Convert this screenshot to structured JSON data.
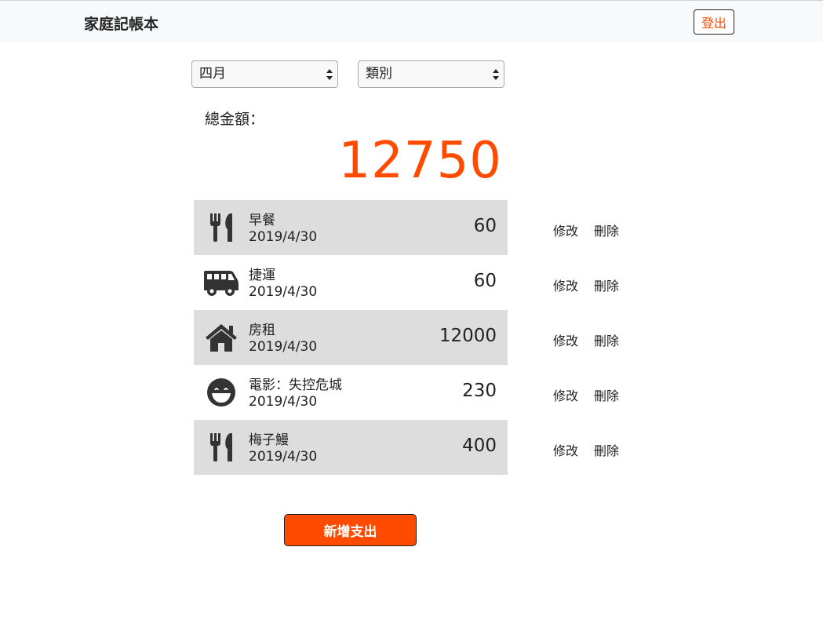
{
  "header": {
    "brand": "家庭記帳本",
    "logout_label": "登出"
  },
  "filters": {
    "month": "四月",
    "category": "類別"
  },
  "summary": {
    "label": "總金額：",
    "total": "12750"
  },
  "expenses": [
    {
      "icon": "utensils-icon",
      "name": "早餐",
      "date": "2019/4/30",
      "amount": "60"
    },
    {
      "icon": "van-icon",
      "name": "捷運",
      "date": "2019/4/30",
      "amount": "60"
    },
    {
      "icon": "home-icon",
      "name": "房租",
      "date": "2019/4/30",
      "amount": "12000"
    },
    {
      "icon": "smile-icon",
      "name": "電影：失控危城",
      "date": "2019/4/30",
      "amount": "230"
    },
    {
      "icon": "utensils-icon",
      "name": "梅子鰻",
      "date": "2019/4/30",
      "amount": "400"
    }
  ],
  "actions": {
    "edit_label": "修改",
    "delete_label": "刪除"
  },
  "add_button_label": "新增支出",
  "colors": {
    "accent": "#ff4b00",
    "row_shade": "#dddddd",
    "navbar_bg": "#f8f9fa"
  }
}
